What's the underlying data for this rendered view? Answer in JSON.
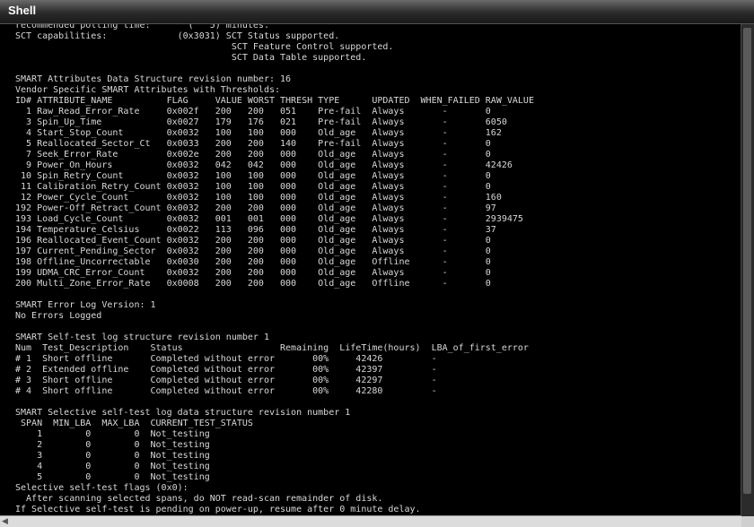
{
  "window": {
    "title": "Shell"
  },
  "scrollbar": {
    "left_arrow": "◀"
  },
  "terminal": {
    "lines": [
      "recommended polling time:       (   5) minutes.",
      "SCT capabilities:             (0x3031) SCT Status supported.",
      "                                        SCT Feature Control supported.",
      "                                        SCT Data Table supported.",
      "",
      "SMART Attributes Data Structure revision number: 16",
      "Vendor Specific SMART Attributes with Thresholds:",
      "ID# ATTRIBUTE_NAME          FLAG     VALUE WORST THRESH TYPE      UPDATED  WHEN_FAILED RAW_VALUE",
      "  1 Raw_Read_Error_Rate     0x002f   200   200   051    Pre-fail  Always       -       0",
      "  3 Spin_Up_Time            0x0027   179   176   021    Pre-fail  Always       -       6050",
      "  4 Start_Stop_Count        0x0032   100   100   000    Old_age   Always       -       162",
      "  5 Reallocated_Sector_Ct   0x0033   200   200   140    Pre-fail  Always       -       0",
      "  7 Seek_Error_Rate         0x002e   200   200   000    Old_age   Always       -       0",
      "  9 Power_On_Hours          0x0032   042   042   000    Old_age   Always       -       42426",
      " 10 Spin_Retry_Count        0x0032   100   100   000    Old_age   Always       -       0",
      " 11 Calibration_Retry_Count 0x0032   100   100   000    Old_age   Always       -       0",
      " 12 Power_Cycle_Count       0x0032   100   100   000    Old_age   Always       -       160",
      "192 Power-Off_Retract_Count 0x0032   200   200   000    Old_age   Always       -       97",
      "193 Load_Cycle_Count        0x0032   001   001   000    Old_age   Always       -       2939475",
      "194 Temperature_Celsius     0x0022   113   096   000    Old_age   Always       -       37",
      "196 Reallocated_Event_Count 0x0032   200   200   000    Old_age   Always       -       0",
      "197 Current_Pending_Sector  0x0032   200   200   000    Old_age   Always       -       0",
      "198 Offline_Uncorrectable   0x0030   200   200   000    Old_age   Offline      -       0",
      "199 UDMA_CRC_Error_Count    0x0032   200   200   000    Old_age   Always       -       0",
      "200 Multi_Zone_Error_Rate   0x0008   200   200   000    Old_age   Offline      -       0",
      "",
      "SMART Error Log Version: 1",
      "No Errors Logged",
      "",
      "SMART Self-test log structure revision number 1",
      "Num  Test_Description    Status                  Remaining  LifeTime(hours)  LBA_of_first_error",
      "# 1  Short offline       Completed without error       00%     42426         -",
      "# 2  Extended offline    Completed without error       00%     42397         -",
      "# 3  Short offline       Completed without error       00%     42297         -",
      "# 4  Short offline       Completed without error       00%     42280         -",
      "",
      "SMART Selective self-test log data structure revision number 1",
      " SPAN  MIN_LBA  MAX_LBA  CURRENT_TEST_STATUS",
      "    1        0        0  Not_testing",
      "    2        0        0  Not_testing",
      "    3        0        0  Not_testing",
      "    4        0        0  Not_testing",
      "    5        0        0  Not_testing",
      "Selective self-test flags (0x0):",
      "  After scanning selected spans, do NOT read-scan remainder of disk.",
      "If Selective self-test is pending on power-up, resume after 0 minute delay."
    ]
  }
}
